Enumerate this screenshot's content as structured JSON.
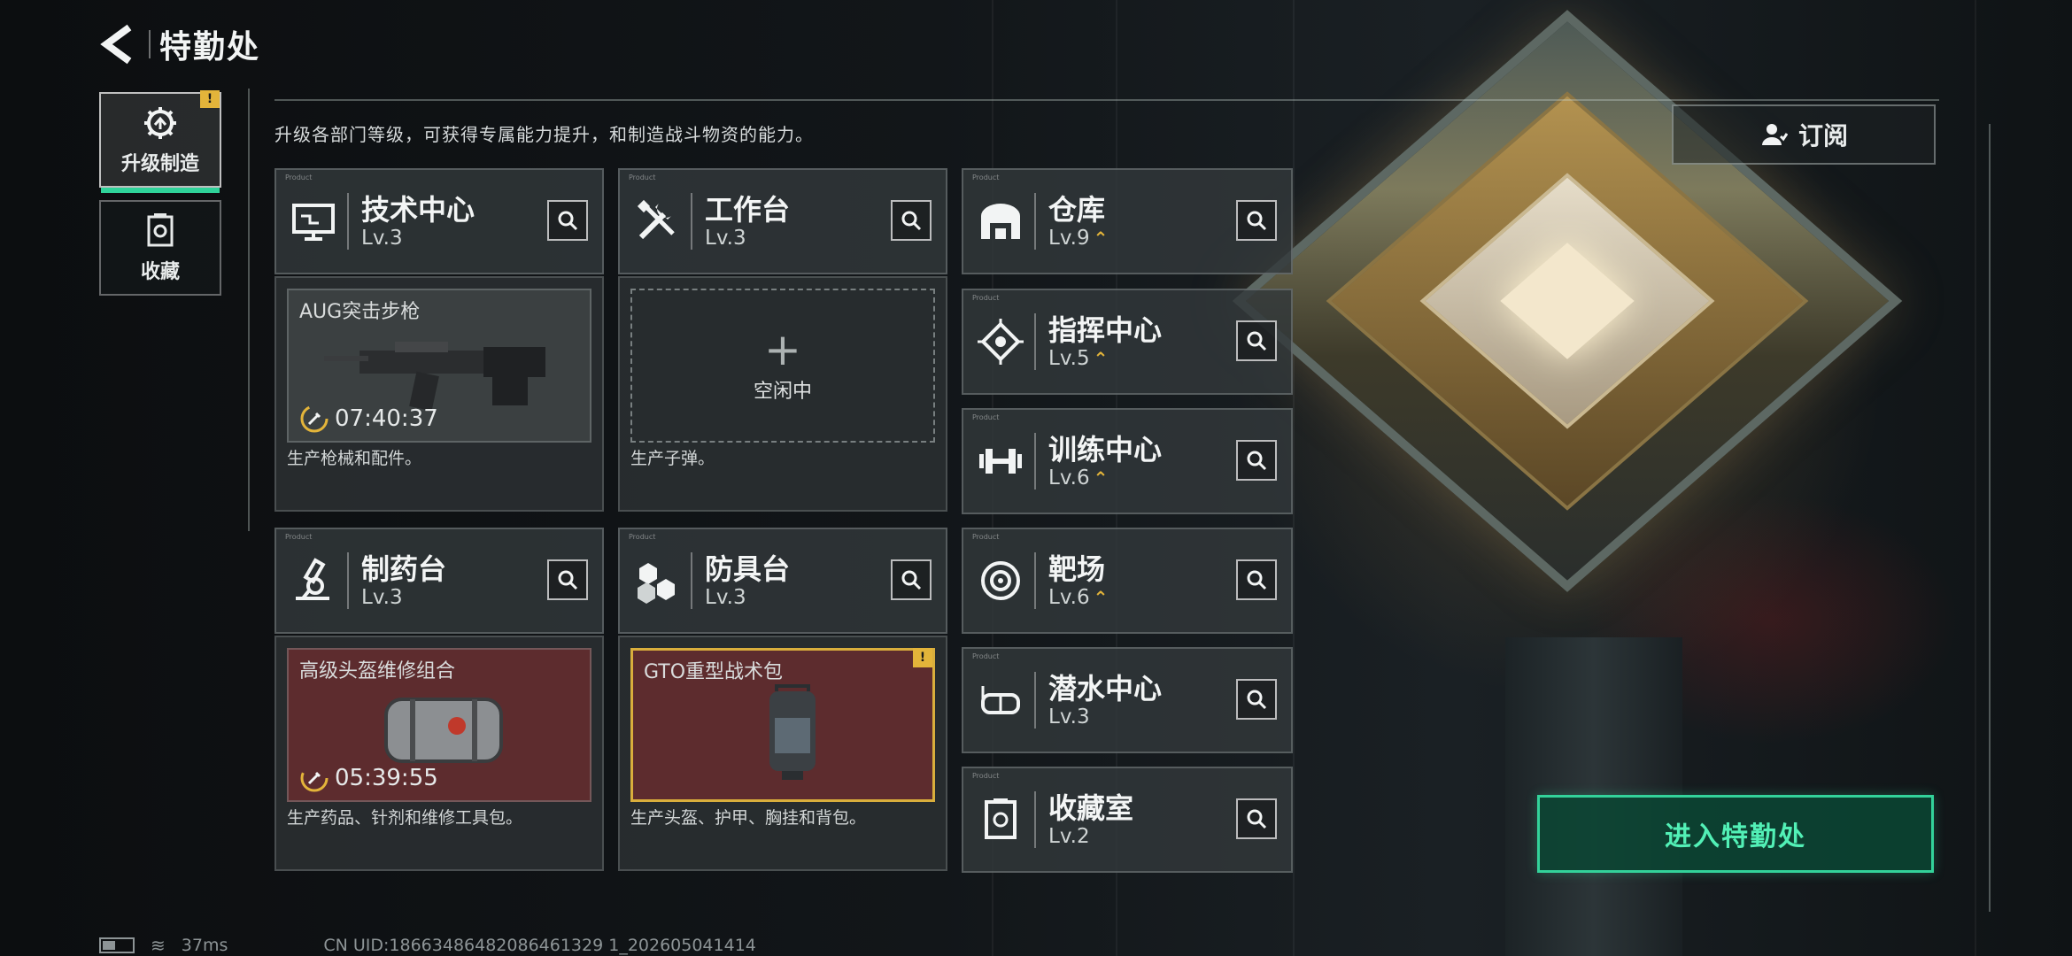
{
  "header": {
    "title": "特勤处"
  },
  "tabs": [
    {
      "label": "升级制造",
      "badge": "!",
      "active": true
    },
    {
      "label": "收藏",
      "active": false
    }
  ],
  "description": "升级各部门等级，可获得专属能力提升，和制造战斗物资的能力。",
  "production_cards": [
    {
      "name": "技术中心",
      "level": "Lv.3",
      "item": "AUG突击步枪",
      "timer": "07:40:37",
      "caption": "生产枪械和配件。"
    },
    {
      "name": "工作台",
      "level": "Lv.3",
      "idle": "空闲中",
      "plus": "+",
      "caption": "生产子弹。"
    },
    {
      "name": "制药台",
      "level": "Lv.3",
      "item": "高级头盔维修组合",
      "timer": "05:39:55",
      "caption": "生产药品、针剂和维修工具包。"
    },
    {
      "name": "防具台",
      "level": "Lv.3",
      "item": "GTO重型战术包",
      "warn": "!",
      "caption": "生产头盔、护甲、胸挂和背包。"
    }
  ],
  "facilities": [
    {
      "name": "仓库",
      "level": "Lv.9",
      "upgradable": true,
      "up_glyph": "⌃"
    },
    {
      "name": "指挥中心",
      "level": "Lv.5",
      "upgradable": true,
      "up_glyph": "⌃"
    },
    {
      "name": "训练中心",
      "level": "Lv.6",
      "upgradable": true,
      "up_glyph": "⌃"
    },
    {
      "name": "靶场",
      "level": "Lv.6",
      "upgradable": true,
      "up_glyph": "⌃"
    },
    {
      "name": "潜水中心",
      "level": "Lv.3",
      "upgradable": false
    },
    {
      "name": "收藏室",
      "level": "Lv.2",
      "upgradable": false
    }
  ],
  "actions": {
    "subscribe": "订阅",
    "enter": "进入特勤处"
  },
  "status": {
    "ping": "37ms",
    "uid": "CN UID:18663486482086461329 1_202605041414"
  },
  "colors": {
    "accent_green": "#33d29a",
    "badge_yellow": "#e3b43a",
    "warm_red_slot": "#602c2e"
  }
}
